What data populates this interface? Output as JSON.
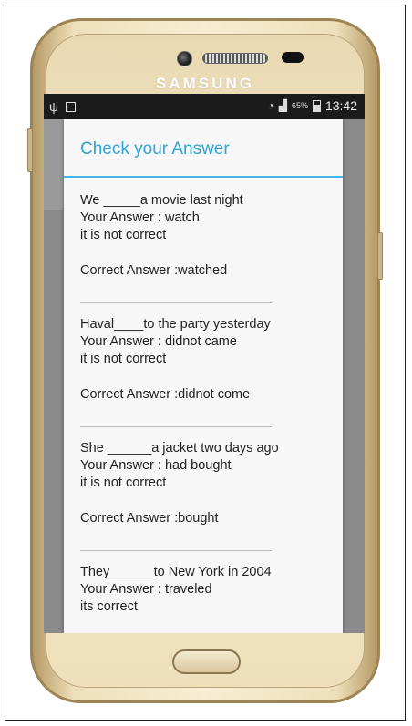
{
  "phone": {
    "brand": "SAMSUNG",
    "statusbar": {
      "battery_pct": "65%",
      "time": "13:42"
    }
  },
  "dialog": {
    "title": "Check your Answer",
    "items": [
      {
        "question": "We _____a movie last night",
        "your_answer": "Your Answer : watch",
        "status": "it is not correct",
        "correct_answer": "Correct Answer :watched"
      },
      {
        "question": "Haval____to the party yesterday",
        "your_answer": "Your Answer : didnot came",
        "status": "it is not correct",
        "correct_answer": "Correct Answer :didnot come"
      },
      {
        "question": "She ______a jacket two days ago",
        "your_answer": "Your Answer : had bought",
        "status": "it is not correct",
        "correct_answer": "Correct Answer :bought"
      },
      {
        "question": "They______to New York in 2004",
        "your_answer": "Your Answer : traveled",
        "status": "its correct"
      }
    ]
  },
  "colors": {
    "accent": "#2fa4d8",
    "phone_gold": "#efe0bb"
  }
}
